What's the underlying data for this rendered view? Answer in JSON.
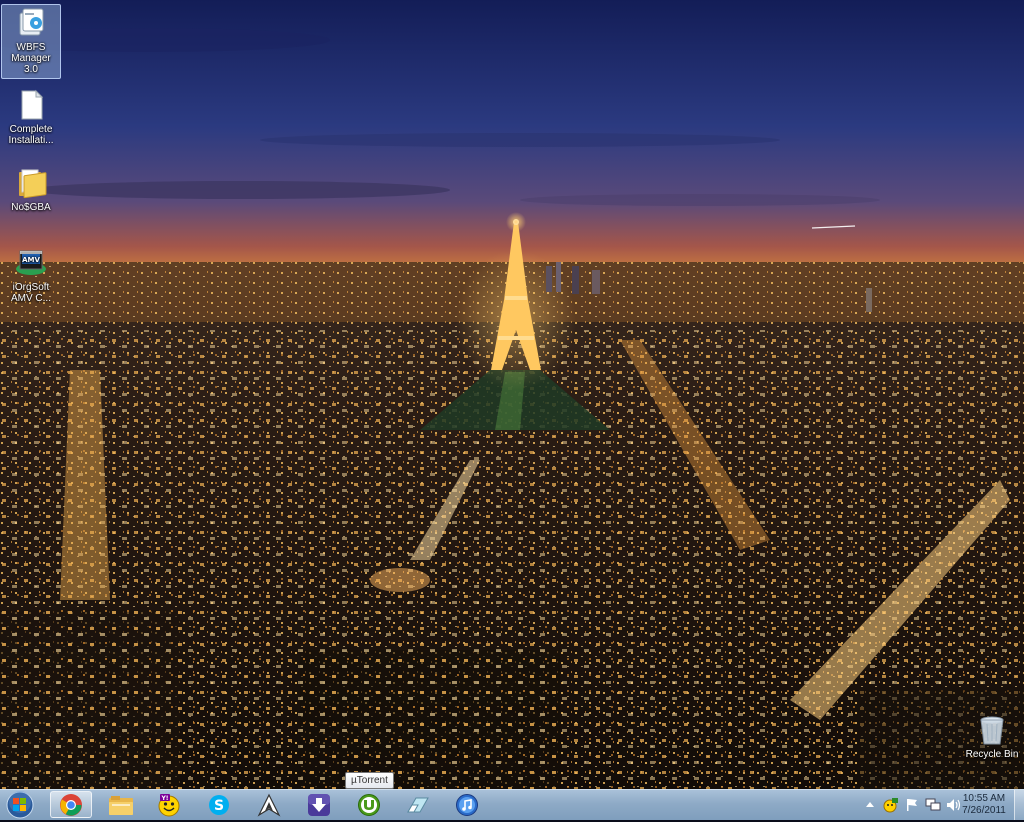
{
  "desktop": {
    "icons": [
      {
        "label": "WBFS Manager 3.0",
        "icon": "wbfs-manager-icon",
        "selected": true
      },
      {
        "label": "Complete Installati...",
        "icon": "document-icon"
      },
      {
        "label": "No$GBA",
        "icon": "folder-icon"
      },
      {
        "label": "iOrgSoft AMV C...",
        "icon": "amv-converter-icon"
      }
    ],
    "recycle_bin": {
      "label": "Recycle Bin",
      "icon": "recycle-bin-icon"
    }
  },
  "taskbar": {
    "start": {
      "icon": "windows-start-icon"
    },
    "pinned": [
      {
        "name": "chrome",
        "icon": "chrome-icon",
        "active": true
      },
      {
        "name": "explorer",
        "icon": "file-explorer-icon"
      },
      {
        "name": "yahoo-messenger",
        "icon": "yahoo-messenger-icon"
      },
      {
        "name": "skype",
        "icon": "skype-icon"
      },
      {
        "name": "arch",
        "icon": "arch-logo-icon"
      },
      {
        "name": "download-manager",
        "icon": "download-arrow-icon"
      },
      {
        "name": "utorrent",
        "icon": "utorrent-icon"
      },
      {
        "name": "eraser",
        "icon": "eraser-icon"
      },
      {
        "name": "itunes",
        "icon": "itunes-icon"
      }
    ],
    "tooltip": "µTorrent",
    "tray": [
      {
        "icon": "show-hidden-icons-arrow"
      },
      {
        "icon": "yellow-smiley-tray-icon"
      },
      {
        "icon": "action-center-flag-icon"
      },
      {
        "icon": "network-icon"
      },
      {
        "icon": "volume-icon"
      }
    ],
    "clock": {
      "time": "10:55 AM",
      "date": "7/26/2011"
    }
  },
  "colors": {
    "taskbar": "#8eaac6",
    "sky_top": "#1a2a6e",
    "horizon": "#c45a2a",
    "city_light": "#f0b040"
  }
}
